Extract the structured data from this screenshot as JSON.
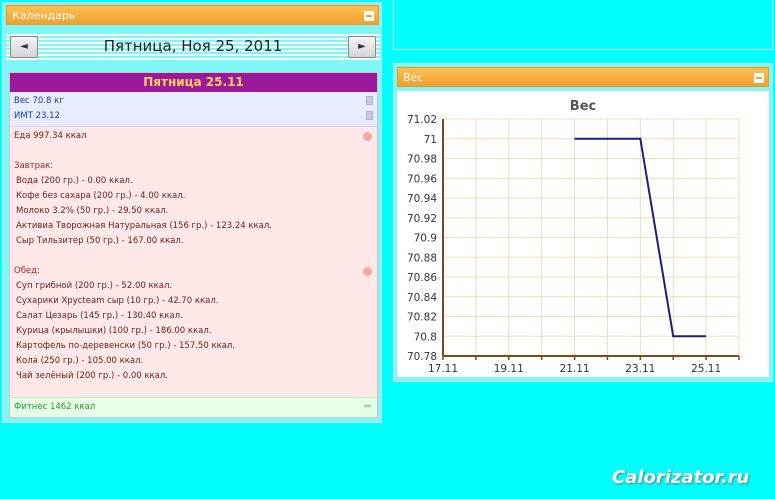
{
  "calendar": {
    "header_title": "Календарь",
    "prev_label": "◄",
    "next_label": "►",
    "date_title": "Пятница, Ноя 25, 2011"
  },
  "day": {
    "title": "Пятница 25.11",
    "weight_text": "Вес 70.8 кг",
    "bmi_text": "ИМТ 23.12",
    "food_total": "Еда 997.34 ккал",
    "meals": [
      {
        "title": "Завтрак:",
        "items": [
          "Вода (200 гр.) - 0.00 ккал.",
          "Кофе без сахара (200 гр.) - 4.00 ккал.",
          "Молоко 3.2% (50 гр.) - 29.50 ккал.",
          "Активиа Творожная Натуральная (156 гр.) - 123.24 ккал.",
          "Сыр Тильзитер (50 гр.) - 167.00 ккал."
        ]
      },
      {
        "title": "Обед:",
        "items": [
          "Суп грибной (200 гр.) - 52.00 ккал.",
          "Сухарики Хрусteam сыр (10 гр.) - 42.70 ккал.",
          "Салат Цезарь (145 гр.) - 130.40 ккал.",
          "Курица (крылышки) (100 гр.) - 186.00 ккал.",
          "Картофель по-деревенски (50 гр.) - 157.50 ккал.",
          "Кола (250 гр.) - 105.00 ккал.",
          "Чай зелёный (200 гр.) - 0.00 ккал."
        ]
      }
    ],
    "fitness_text": "Фитнес 1462 ккал"
  },
  "weight_panel": {
    "header_title": "Вес"
  },
  "chart_data": {
    "type": "line",
    "title": "Вес",
    "xlabel": "",
    "ylabel": "",
    "x_ticks": [
      "17.11",
      "19.11",
      "21.11",
      "23.11",
      "25.11"
    ],
    "y_ticks": [
      "71.02",
      "71",
      "70.98",
      "70.96",
      "70.94",
      "70.92",
      "70.9",
      "70.88",
      "70.86",
      "70.84",
      "70.82",
      "70.8",
      "70.78"
    ],
    "xlim": [
      "17.11",
      "26.11"
    ],
    "ylim": [
      70.78,
      71.02
    ],
    "grid": true,
    "series": [
      {
        "color": "#1a1f7a",
        "x": [
          "21.11",
          "23.11",
          "24.11",
          "25.11"
        ],
        "y": [
          71,
          71,
          70.8,
          70.8
        ]
      }
    ]
  },
  "watermark": "Calorizator.ru",
  "colors": {
    "background": "#00ffff",
    "header_orange": "#f0a030",
    "day_title_bg": "#9b1a9b",
    "day_title_text": "#ffd25a",
    "line": "#1a1f7a"
  }
}
